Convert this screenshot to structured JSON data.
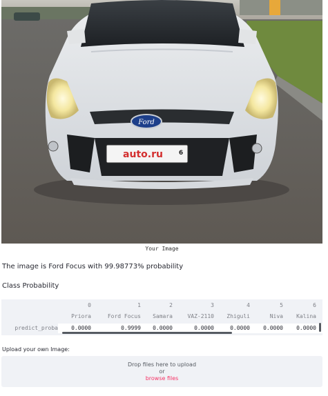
{
  "image": {
    "caption": "Your Image",
    "plate_text": "auto.ru",
    "plate_number": "6",
    "badge_text": "Ford"
  },
  "result": {
    "text": "The image is Ford Focus with 99.98773% probability"
  },
  "class_probability": {
    "title": "Class Probability",
    "row_label": "predict_proba",
    "columns": [
      {
        "index": "0",
        "name": "Priora",
        "value": "0.0000"
      },
      {
        "index": "1",
        "name": "Ford Focus",
        "value": "0.9999"
      },
      {
        "index": "2",
        "name": "Samara",
        "value": "0.0000"
      },
      {
        "index": "3",
        "name": "VAZ-2110",
        "value": "0.0000"
      },
      {
        "index": "4",
        "name": "Zhiguli",
        "value": "0.0000"
      },
      {
        "index": "5",
        "name": "Niva",
        "value": "0.0000"
      },
      {
        "index": "6",
        "name": "Kalina",
        "value": "0.0000"
      }
    ]
  },
  "uploader": {
    "label": "Upload your own Image:",
    "drop_text": "Drop files here to upload",
    "or_text": "or",
    "browse_text": "browse files"
  },
  "colors": {
    "accent": "#f63366",
    "panel_bg": "#f0f2f6",
    "text": "#262730",
    "muted": "#7d7f86"
  }
}
